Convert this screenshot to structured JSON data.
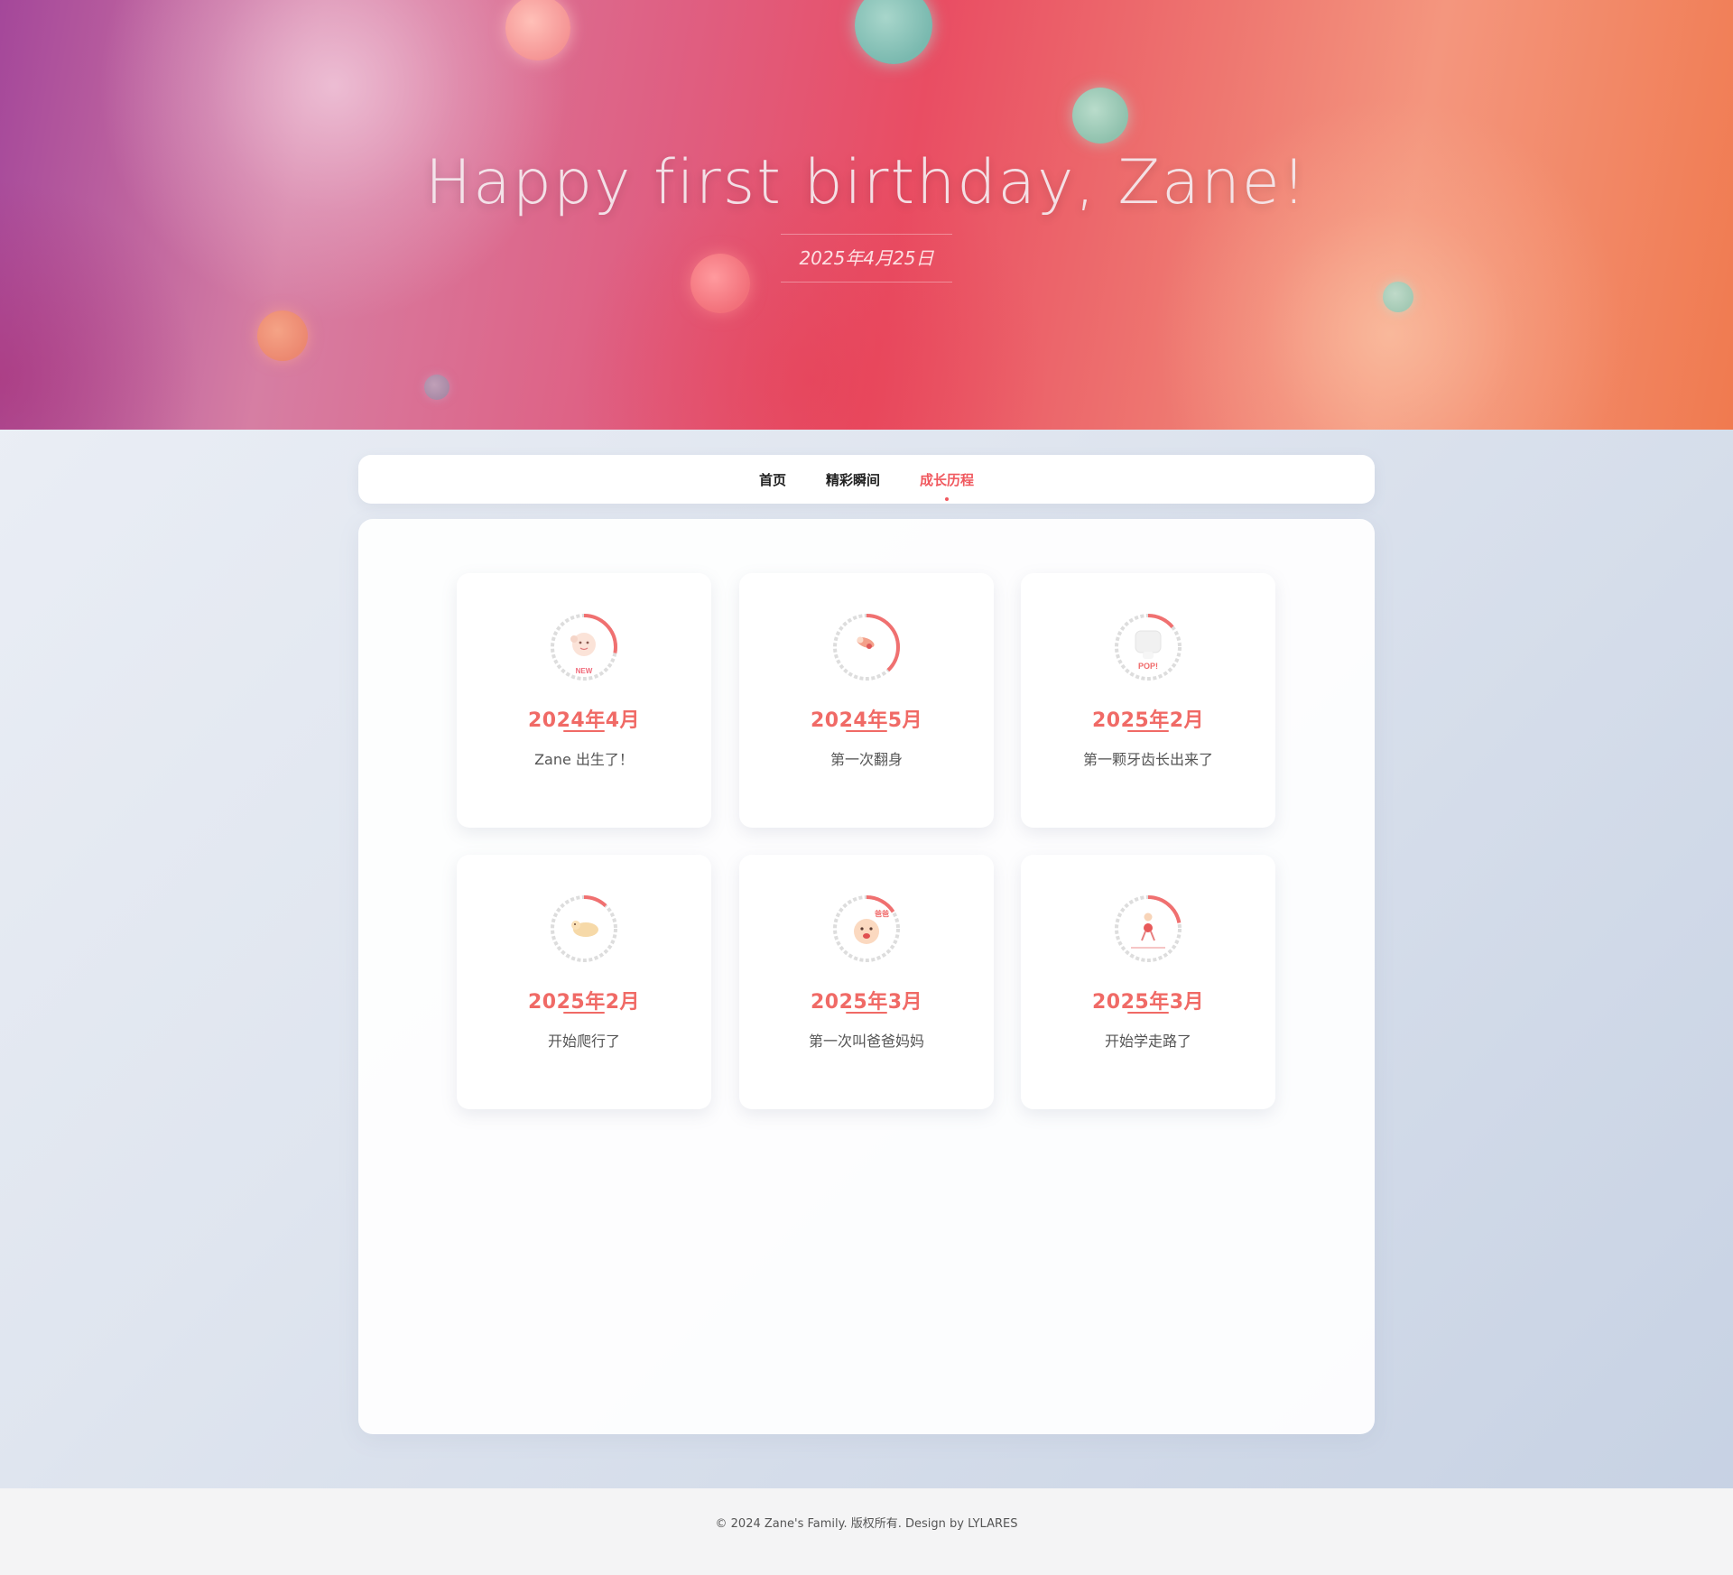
{
  "hero": {
    "title": "Happy first birthday, Zane!",
    "date": "2025年4月25日"
  },
  "nav": {
    "items": [
      {
        "label": "首页",
        "active": false
      },
      {
        "label": "精彩瞬间",
        "active": false
      },
      {
        "label": "成长历程",
        "active": true
      }
    ]
  },
  "timeline": [
    {
      "date": "2024年4月",
      "text": "Zane 出生了！",
      "icon": "newborn-icon",
      "badge": "NEW"
    },
    {
      "date": "2024年5月",
      "text": "第一次翻身",
      "icon": "rolling-baby-icon",
      "badge": ""
    },
    {
      "date": "2025年2月",
      "text": "第一颗牙齿长出来了",
      "icon": "tooth-icon",
      "badge": "POP!"
    },
    {
      "date": "2025年2月",
      "text": "开始爬行了",
      "icon": "crawling-baby-icon",
      "badge": ""
    },
    {
      "date": "2025年3月",
      "text": "第一次叫爸爸妈妈",
      "icon": "talking-baby-icon",
      "badge": "爸爸"
    },
    {
      "date": "2025年3月",
      "text": "开始学走路了",
      "icon": "walking-baby-icon",
      "badge": ""
    }
  ],
  "footer": {
    "text": "© 2024 Zane's Family. 版权所有. Design by LYLARES"
  },
  "colors": {
    "accent": "#f06a66",
    "nav_active": "#f0585e"
  }
}
